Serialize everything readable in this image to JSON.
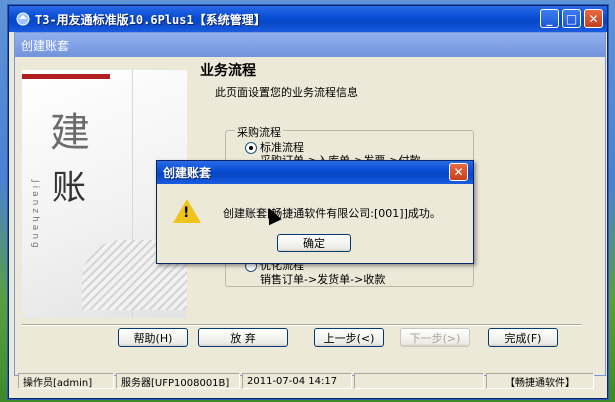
{
  "main_window": {
    "title": "T3-用友通标准版10.6Plus1【系统管理】",
    "minimize": "_",
    "maximize": "□",
    "close": "✕"
  },
  "wizard": {
    "title": "创建账套",
    "heading": "业务流程",
    "subtitle": "此页面设置您的业务流程信息",
    "side_image": {
      "char1": "建",
      "char2": "账",
      "vertical": "Jianzhang"
    },
    "purchase_group": {
      "label": "采购流程",
      "standard_label": "标准流程",
      "standard_desc": "采购订单->入库单->发票->付款"
    },
    "sales_group": {
      "optimized_label": "优化流程",
      "optimized_desc": "销售订单->发货单->收款"
    },
    "buttons": {
      "help": "帮助(H)",
      "abandon": "放 弃",
      "prev": "上一步(<)",
      "next": "下一步(>)",
      "finish": "完成(F)"
    }
  },
  "statusbar": {
    "operator": "操作员[admin]",
    "server": "服务器[UFP1008001B]",
    "datetime": "2011-07-04 14:17",
    "company": "【畅捷通软件】"
  },
  "dialog": {
    "title": "创建账套",
    "close": "✕",
    "message": "创建账套[畅捷通软件有限公司:[001]]成功。",
    "ok": "确定"
  },
  "colors": {
    "xp_blue": "#0a4fd6",
    "close_red": "#c2411d",
    "warning_yellow": "#f0c419"
  }
}
